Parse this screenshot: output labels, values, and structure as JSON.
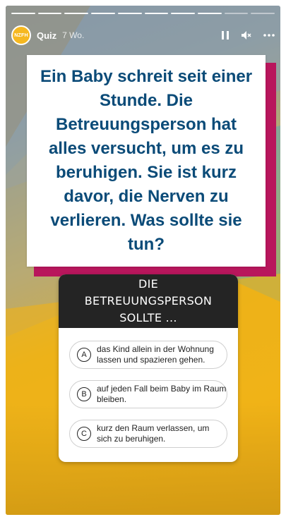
{
  "story": {
    "progress_segments": 10,
    "progress_done": 8,
    "account_avatar_text": "NZFH",
    "account_name": "Quiz",
    "age": "7 Wo.",
    "icons": [
      "pause-icon",
      "mute-icon",
      "more-icon"
    ]
  },
  "question": {
    "text": "Ein Baby schreit seit einer Stunde. Die Betreuungsperson hat alles versucht, um es zu beruhigen. Sie ist kurz davor, die Nerven zu verlieren. Was sollte sie tun?"
  },
  "quiz": {
    "header": "DIE BETREUUNGSPERSON SOLLTE ...",
    "options": [
      {
        "letter": "A",
        "text": "das Kind allein in der Wohnung lassen und spazieren gehen."
      },
      {
        "letter": "B",
        "text": "auf jeden Fall beim Baby im Raum bleiben."
      },
      {
        "letter": "C",
        "text": "kurz den Raum verlassen, um sich zu beruhigen."
      }
    ]
  },
  "colors": {
    "question_text": "#0b4b78",
    "accent_shadow": "#b8165c",
    "quiz_header_bg": "#242424",
    "background_yellow": "#f0b318"
  }
}
